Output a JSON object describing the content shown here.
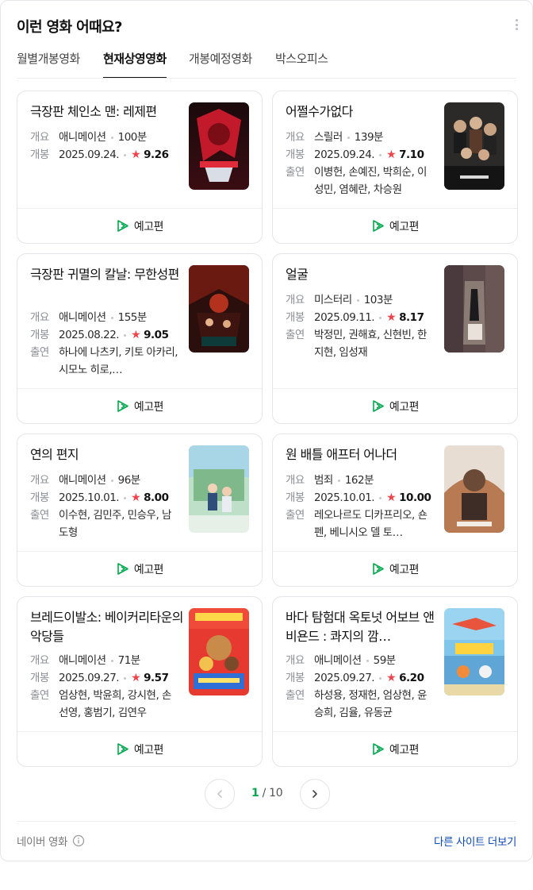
{
  "header": {
    "title": "이런 영화 어때요?",
    "more_icon": "more-vertical-icon"
  },
  "tabs": [
    {
      "label": "월별개봉영화",
      "active": false
    },
    {
      "label": "현재상영영화",
      "active": true
    },
    {
      "label": "개봉예정영화",
      "active": false
    },
    {
      "label": "박스오피스",
      "active": false
    }
  ],
  "labels": {
    "overview": "개요",
    "release": "개봉",
    "cast": "출연",
    "trailer": "예고편"
  },
  "colors": {
    "accent": "#03a94d",
    "star": "#f0444a",
    "link": "#0b4ab5"
  },
  "movies": [
    {
      "title": "극장판 체인소 맨: 레제편",
      "genre": "애니메이션",
      "runtime": "100분",
      "date": "2025.09.24.",
      "rating": "9.26",
      "cast": ""
    },
    {
      "title": "어쩔수가없다",
      "genre": "스릴러",
      "runtime": "139분",
      "date": "2025.09.24.",
      "rating": "7.10",
      "cast": "이병헌, 손예진, 박희순, 이성민, 염혜란, 차승원"
    },
    {
      "title": "극장판 귀멸의 칼날: 무한성편",
      "genre": "애니메이션",
      "runtime": "155분",
      "date": "2025.08.22.",
      "rating": "9.05",
      "cast": "하나에 나츠키, 키토 아카리, 시모노 히로,…"
    },
    {
      "title": "얼굴",
      "genre": "미스터리",
      "runtime": "103분",
      "date": "2025.09.11.",
      "rating": "8.17",
      "cast": "박정민, 권해효, 신현빈, 한지현, 임성재"
    },
    {
      "title": "연의 편지",
      "genre": "애니메이션",
      "runtime": "96분",
      "date": "2025.10.01.",
      "rating": "8.00",
      "cast": "이수현, 김민주, 민승우, 남도형"
    },
    {
      "title": "원 배틀 애프터 어나더",
      "genre": "범죄",
      "runtime": "162분",
      "date": "2025.10.01.",
      "rating": "10.00",
      "cast": "레오나르도 디카프리오, 숀 펜, 베니시오 델 토…"
    },
    {
      "title": "브레드이발소: 베이커리타운의 악당들",
      "genre": "애니메이션",
      "runtime": "71분",
      "date": "2025.09.27.",
      "rating": "9.57",
      "cast": "엄상현, 박윤희, 강시현, 손선영, 홍범기, 김연우"
    },
    {
      "title": "바다 탐험대 옥토넛 어보브 앤 비욘드 : 콰지의 깜…",
      "genre": "애니메이션",
      "runtime": "59분",
      "date": "2025.09.27.",
      "rating": "6.20",
      "cast": "하성용, 정재헌, 엄상현, 윤승희, 김율, 유동균"
    }
  ],
  "pagination": {
    "current": "1",
    "total": "/ 10"
  },
  "footer": {
    "source": "네이버 영화",
    "other_sites": "다른 사이트 더보기"
  }
}
